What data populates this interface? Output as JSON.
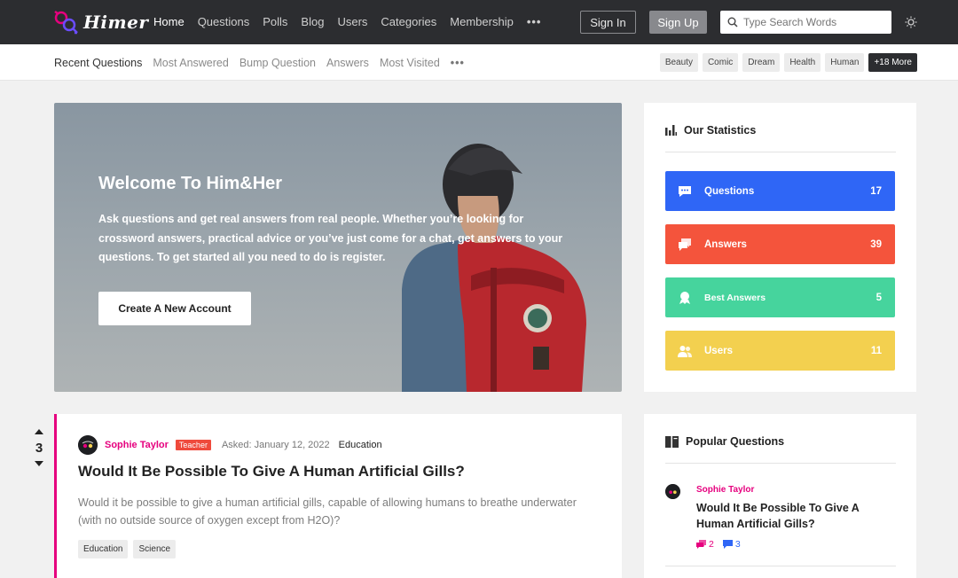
{
  "app": {
    "logo_text": "Himer"
  },
  "nav": {
    "items": [
      {
        "label": "Home",
        "active": true
      },
      {
        "label": "Questions"
      },
      {
        "label": "Polls"
      },
      {
        "label": "Blog"
      },
      {
        "label": "Users"
      },
      {
        "label": "Categories"
      },
      {
        "label": "Membership"
      }
    ],
    "more_icon": "ellipsis-icon",
    "signin_label": "Sign In",
    "signup_label": "Sign Up",
    "search_placeholder": "Type Search Words",
    "theme_icon": "sun-icon"
  },
  "subnav": {
    "items": [
      {
        "label": "Recent Questions",
        "active": true
      },
      {
        "label": "Most Answered"
      },
      {
        "label": "Bump Question"
      },
      {
        "label": "Answers"
      },
      {
        "label": "Most Visited"
      }
    ],
    "tags": [
      "Beauty",
      "Comic",
      "Dream",
      "Health",
      "Human"
    ],
    "more_tags_label": "+18 More"
  },
  "hero": {
    "title": "Welcome To Him&Her",
    "text": "Ask questions and get real answers from real people. Whether you’re looking for crossword answers, practical advice or you’ve just come for a chat, get answers to your questions. To get started all you need to do is register.",
    "button_label": "Create A New Account"
  },
  "stats": {
    "title": "Our Statistics",
    "items": [
      {
        "label": "Questions",
        "value": "17",
        "color": "#2f66f6",
        "icon": "chat-icon"
      },
      {
        "label": "Answers",
        "value": "39",
        "color": "#f4543c",
        "icon": "answers-icon"
      },
      {
        "label": "Best Answers",
        "value": "5",
        "color": "#46d49d",
        "icon": "award-icon"
      },
      {
        "label": "Users",
        "value": "11",
        "color": "#f3d04f",
        "icon": "users-icon"
      }
    ]
  },
  "question": {
    "votes": "3",
    "author": "Sophie Taylor",
    "badge": "Teacher",
    "asked": "Asked: January 12, 2022",
    "category": "Education",
    "title": "Would It Be Possible To Give A Human Artificial Gills?",
    "body": "Would it be possible to give a human artificial gills, capable of allowing humans to breathe underwater (with no outside source of oxygen except from H2O)?",
    "tags": [
      "Education",
      "Science"
    ],
    "accent": "#e6007e"
  },
  "popular": {
    "title": "Popular Questions",
    "items": [
      {
        "author": "Sophie Taylor",
        "title": "Would It Be Possible To Give A Human Artificial Gills?",
        "answers": "2",
        "comments": "3"
      }
    ]
  }
}
